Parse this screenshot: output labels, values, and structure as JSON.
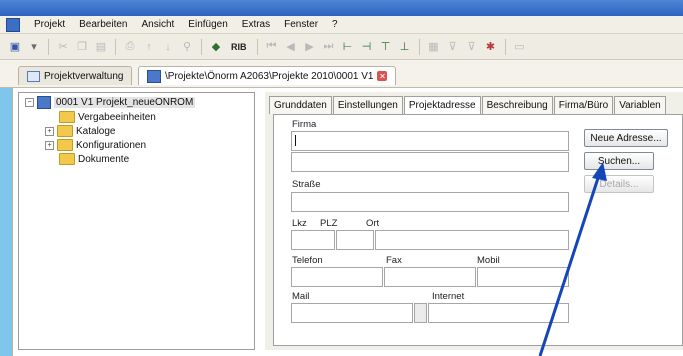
{
  "menu": {
    "items": [
      "Projekt",
      "Bearbeiten",
      "Ansicht",
      "Einfügen",
      "Extras",
      "Fenster",
      "?"
    ]
  },
  "toolbar": {
    "rib_label": "RIB"
  },
  "doc_tabs": {
    "tab1": "Projektverwaltung",
    "tab2": "\\Projekte\\Önorm A2063\\Projekte 2010\\0001 V1"
  },
  "tree": {
    "root": "0001 V1 Projekt_neueONROM",
    "children": [
      "Vergabeeinheiten",
      "Kataloge",
      "Konfigurationen",
      "Dokumente"
    ]
  },
  "panel": {
    "tabs": [
      "Grunddaten",
      "Einstellungen",
      "Projektadresse",
      "Beschreibung",
      "Firma/Büro",
      "Variablen"
    ],
    "active_tab": "Projektadresse"
  },
  "form": {
    "firma_label": "Firma",
    "strasse_label": "Straße",
    "lkz_label": "Lkz",
    "plz_label": "PLZ",
    "ort_label": "Ort",
    "telefon_label": "Telefon",
    "fax_label": "Fax",
    "mobil_label": "Mobil",
    "mail_label": "Mail",
    "internet_label": "Internet"
  },
  "buttons": {
    "neue_adresse": "Neue Adresse...",
    "suchen": "Suchen...",
    "details": "Details..."
  },
  "colors": {
    "background": "#7ec6ea",
    "arrow": "#1446b8"
  }
}
